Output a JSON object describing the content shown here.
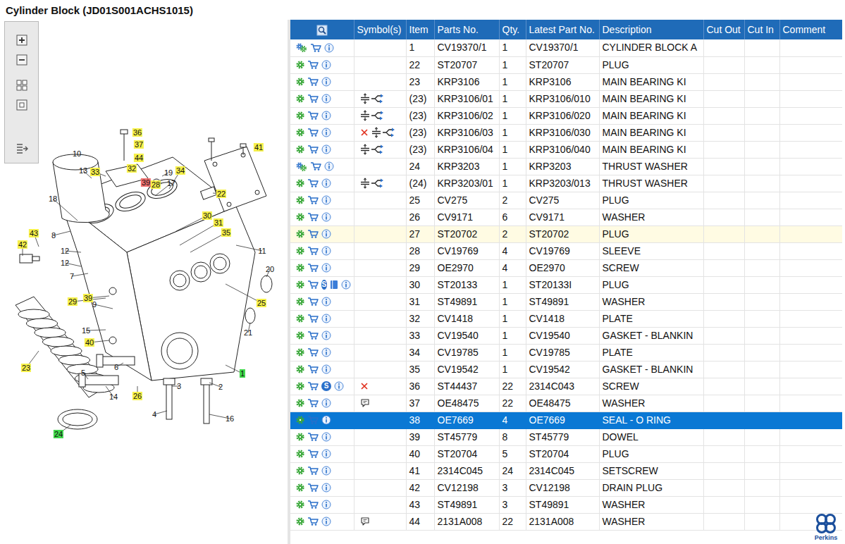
{
  "title": "Cylinder Block (JD01S001ACHS1015)",
  "diagram": {
    "callouts": [
      {
        "label": "36",
        "kind": "listed"
      },
      {
        "label": "37",
        "kind": "listed"
      },
      {
        "label": "41",
        "kind": "listed"
      },
      {
        "label": "10",
        "kind": "plain"
      },
      {
        "label": "44",
        "kind": "listed"
      },
      {
        "label": "13",
        "kind": "plain"
      },
      {
        "label": "33",
        "kind": "listed"
      },
      {
        "label": "32",
        "kind": "listed"
      },
      {
        "label": "19",
        "kind": "plain"
      },
      {
        "label": "34",
        "kind": "listed"
      },
      {
        "label": "39",
        "kind": "selected"
      },
      {
        "label": "28",
        "kind": "listed"
      },
      {
        "label": "17",
        "kind": "plain"
      },
      {
        "label": "22",
        "kind": "listed"
      },
      {
        "label": "18",
        "kind": "plain"
      },
      {
        "label": "30",
        "kind": "listed"
      },
      {
        "label": "31",
        "kind": "listed"
      },
      {
        "label": "35",
        "kind": "listed"
      },
      {
        "label": "43",
        "kind": "listed"
      },
      {
        "label": "8",
        "kind": "plain"
      },
      {
        "label": "42",
        "kind": "listed"
      },
      {
        "label": "12",
        "kind": "plain"
      },
      {
        "label": "11",
        "kind": "plain"
      },
      {
        "label": "12",
        "kind": "plain"
      },
      {
        "label": "20",
        "kind": "plain"
      },
      {
        "label": "7",
        "kind": "plain"
      },
      {
        "label": "29",
        "kind": "listed"
      },
      {
        "label": "39",
        "kind": "listed"
      },
      {
        "label": "9",
        "kind": "plain"
      },
      {
        "label": "25",
        "kind": "listed"
      },
      {
        "label": "15",
        "kind": "plain"
      },
      {
        "label": "21",
        "kind": "plain"
      },
      {
        "label": "40",
        "kind": "listed"
      },
      {
        "label": "6",
        "kind": "plain"
      },
      {
        "label": "5",
        "kind": "plain"
      },
      {
        "label": "23",
        "kind": "listed"
      },
      {
        "label": "1",
        "kind": "assembly"
      },
      {
        "label": "3",
        "kind": "plain"
      },
      {
        "label": "2",
        "kind": "plain"
      },
      {
        "label": "14",
        "kind": "plain"
      },
      {
        "label": "26",
        "kind": "listed"
      },
      {
        "label": "4",
        "kind": "plain"
      },
      {
        "label": "16",
        "kind": "plain"
      },
      {
        "label": "24",
        "kind": "assembly"
      }
    ]
  },
  "table": {
    "columns": [
      {
        "label": "",
        "kind": "search"
      },
      {
        "label": "Symbol(s)",
        "kind": "text"
      },
      {
        "label": "Item",
        "kind": "text"
      },
      {
        "label": "Parts No.",
        "kind": "text"
      },
      {
        "label": "Qty.",
        "kind": "text"
      },
      {
        "label": "Latest Part No.",
        "kind": "text"
      },
      {
        "label": "Description",
        "kind": "text"
      },
      {
        "label": "Cut Out",
        "kind": "text"
      },
      {
        "label": "Cut In",
        "kind": "text"
      },
      {
        "label": "Comment",
        "kind": "text"
      }
    ],
    "rows": [
      {
        "item": "1",
        "part": "CV19370/1",
        "qty": "1",
        "latest": "CV19370/1",
        "description": "CYLINDER BLOCK A",
        "kind": "assembly",
        "symbols": [],
        "badge": "",
        "manual": false,
        "selected": false,
        "highlighted": false
      },
      {
        "item": "22",
        "part": "ST20707",
        "qty": "1",
        "latest": "ST20707",
        "description": "PLUG",
        "kind": "part",
        "symbols": [],
        "badge": "",
        "manual": false,
        "selected": false,
        "highlighted": false
      },
      {
        "item": "23",
        "part": "KRP3106",
        "qty": "1",
        "latest": "KRP3106",
        "description": "MAIN BEARING KI",
        "kind": "part",
        "symbols": [],
        "badge": "",
        "manual": false,
        "selected": false,
        "highlighted": false
      },
      {
        "item": "(23)",
        "part": "KRP3106/01",
        "qty": "1",
        "latest": "KRP3106/010",
        "description": "MAIN BEARING KI",
        "kind": "part",
        "symbols": [
          "oversize"
        ],
        "badge": "",
        "manual": false,
        "selected": false,
        "highlighted": false
      },
      {
        "item": "(23)",
        "part": "KRP3106/02",
        "qty": "1",
        "latest": "KRP3106/020",
        "description": "MAIN BEARING KI",
        "kind": "part",
        "symbols": [
          "oversize"
        ],
        "badge": "",
        "manual": false,
        "selected": false,
        "highlighted": false
      },
      {
        "item": "(23)",
        "part": "KRP3106/03",
        "qty": "1",
        "latest": "KRP3106/030",
        "description": "MAIN BEARING KI",
        "kind": "part",
        "symbols": [
          "superseded",
          "oversize"
        ],
        "badge": "",
        "manual": false,
        "selected": false,
        "highlighted": false
      },
      {
        "item": "(23)",
        "part": "KRP3106/04",
        "qty": "1",
        "latest": "KRP3106/040",
        "description": "MAIN BEARING KI",
        "kind": "part",
        "symbols": [
          "oversize"
        ],
        "badge": "",
        "manual": false,
        "selected": false,
        "highlighted": false
      },
      {
        "item": "24",
        "part": "KRP3203",
        "qty": "1",
        "latest": "KRP3203",
        "description": "THRUST WASHER",
        "kind": "assembly",
        "symbols": [],
        "badge": "",
        "manual": false,
        "selected": false,
        "highlighted": false
      },
      {
        "item": "(24)",
        "part": "KRP3203/01",
        "qty": "1",
        "latest": "KRP3203/013",
        "description": "THRUST WASHER",
        "kind": "part",
        "symbols": [
          "oversize"
        ],
        "badge": "",
        "manual": false,
        "selected": false,
        "highlighted": false
      },
      {
        "item": "25",
        "part": "CV275",
        "qty": "2",
        "latest": "CV275",
        "description": "PLUG",
        "kind": "part",
        "symbols": [],
        "badge": "",
        "manual": false,
        "selected": false,
        "highlighted": false
      },
      {
        "item": "26",
        "part": "CV9171",
        "qty": "6",
        "latest": "CV9171",
        "description": "WASHER",
        "kind": "part",
        "symbols": [],
        "badge": "",
        "manual": false,
        "selected": false,
        "highlighted": false
      },
      {
        "item": "27",
        "part": "ST20702",
        "qty": "2",
        "latest": "ST20702",
        "description": "PLUG",
        "kind": "part",
        "symbols": [],
        "badge": "",
        "manual": false,
        "selected": false,
        "highlighted": true
      },
      {
        "item": "28",
        "part": "CV19769",
        "qty": "4",
        "latest": "CV19769",
        "description": "SLEEVE",
        "kind": "part",
        "symbols": [],
        "badge": "",
        "manual": false,
        "selected": false,
        "highlighted": false
      },
      {
        "item": "29",
        "part": "OE2970",
        "qty": "4",
        "latest": "OE2970",
        "description": "SCREW",
        "kind": "part",
        "symbols": [],
        "badge": "",
        "manual": false,
        "selected": false,
        "highlighted": false
      },
      {
        "item": "30",
        "part": "ST20133",
        "qty": "1",
        "latest": "ST20133I",
        "description": "PLUG",
        "kind": "part",
        "symbols": [],
        "badge": "S",
        "manual": true,
        "selected": false,
        "highlighted": false
      },
      {
        "item": "31",
        "part": "ST49891",
        "qty": "1",
        "latest": "ST49891",
        "description": "WASHER",
        "kind": "part",
        "symbols": [],
        "badge": "",
        "manual": false,
        "selected": false,
        "highlighted": false
      },
      {
        "item": "32",
        "part": "CV1418",
        "qty": "1",
        "latest": "CV1418",
        "description": "PLATE",
        "kind": "part",
        "symbols": [],
        "badge": "",
        "manual": false,
        "selected": false,
        "highlighted": false
      },
      {
        "item": "33",
        "part": "CV19540",
        "qty": "1",
        "latest": "CV19540",
        "description": "GASKET - BLANKIN",
        "kind": "part",
        "symbols": [],
        "badge": "",
        "manual": false,
        "selected": false,
        "highlighted": false
      },
      {
        "item": "34",
        "part": "CV19785",
        "qty": "1",
        "latest": "CV19785",
        "description": "PLATE",
        "kind": "part",
        "symbols": [],
        "badge": "",
        "manual": false,
        "selected": false,
        "highlighted": false
      },
      {
        "item": "35",
        "part": "CV19542",
        "qty": "1",
        "latest": "CV19542",
        "description": "GASKET - BLANKIN",
        "kind": "part",
        "symbols": [],
        "badge": "",
        "manual": false,
        "selected": false,
        "highlighted": false
      },
      {
        "item": "36",
        "part": "ST44437",
        "qty": "22",
        "latest": "2314C043",
        "description": "SCREW",
        "kind": "part",
        "symbols": [
          "superseded"
        ],
        "badge": "S",
        "manual": false,
        "selected": false,
        "highlighted": false
      },
      {
        "item": "37",
        "part": "OE48475",
        "qty": "22",
        "latest": "OE48475",
        "description": "WASHER",
        "kind": "part",
        "symbols": [
          "note"
        ],
        "badge": "",
        "manual": false,
        "selected": false,
        "highlighted": false
      },
      {
        "item": "38",
        "part": "OE7669",
        "qty": "4",
        "latest": "OE7669",
        "description": "SEAL - O RING",
        "kind": "part",
        "symbols": [],
        "badge": "",
        "manual": false,
        "selected": true,
        "highlighted": false
      },
      {
        "item": "39",
        "part": "ST45779",
        "qty": "8",
        "latest": "ST45779",
        "description": "DOWEL",
        "kind": "part",
        "symbols": [],
        "badge": "",
        "manual": false,
        "selected": false,
        "highlighted": false
      },
      {
        "item": "40",
        "part": "ST20704",
        "qty": "5",
        "latest": "ST20704",
        "description": "PLUG",
        "kind": "part",
        "symbols": [],
        "badge": "",
        "manual": false,
        "selected": false,
        "highlighted": false
      },
      {
        "item": "41",
        "part": "2314C045",
        "qty": "24",
        "latest": "2314C045",
        "description": "SETSCREW",
        "kind": "part",
        "symbols": [],
        "badge": "",
        "manual": false,
        "selected": false,
        "highlighted": false
      },
      {
        "item": "42",
        "part": "CV12198",
        "qty": "3",
        "latest": "CV12198",
        "description": "DRAIN PLUG",
        "kind": "part",
        "symbols": [],
        "badge": "",
        "manual": false,
        "selected": false,
        "highlighted": false
      },
      {
        "item": "43",
        "part": "ST49891",
        "qty": "3",
        "latest": "ST49891",
        "description": "WASHER",
        "kind": "part",
        "symbols": [],
        "badge": "",
        "manual": false,
        "selected": false,
        "highlighted": false
      },
      {
        "item": "44",
        "part": "2131A008",
        "qty": "22",
        "latest": "2131A008",
        "description": "WASHER",
        "kind": "part",
        "symbols": [
          "note"
        ],
        "badge": "",
        "manual": false,
        "selected": false,
        "highlighted": false
      }
    ]
  },
  "logo": {
    "text": "Perkins"
  }
}
